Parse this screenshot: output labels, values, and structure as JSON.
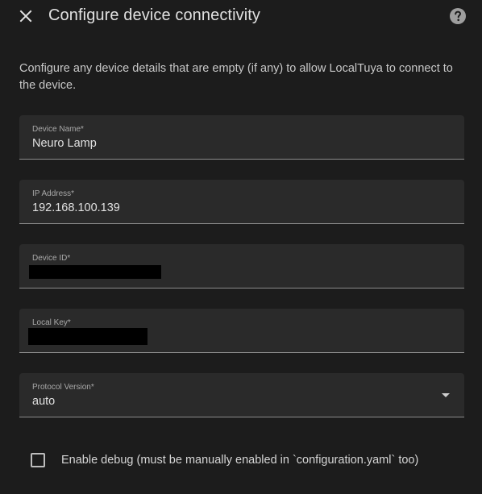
{
  "dialog": {
    "title": "Configure device connectivity",
    "close_icon": "close-icon",
    "help_icon": "help-circle-icon",
    "description": "Configure any device details that are empty (if any) to allow LocalTuya to connect to the device."
  },
  "fields": {
    "device_name": {
      "label": "Device Name*",
      "value": "Neuro Lamp"
    },
    "ip_address": {
      "label": "IP Address*",
      "value": "192.168.100.139"
    },
    "device_id": {
      "label": "Device ID*",
      "value": ""
    },
    "local_key": {
      "label": "Local Key*",
      "value": ""
    },
    "protocol_version": {
      "label": "Protocol Version*",
      "value": "auto",
      "icon": "chevron-down-icon"
    }
  },
  "debug": {
    "label": "Enable debug (must be manually enabled in `configuration.yaml` too)",
    "checked": false
  },
  "colors": {
    "background": "#1c1c1c",
    "field_background": "#2a2a2a",
    "text_primary": "#e1e1e1",
    "label": "#a9a9a9"
  }
}
